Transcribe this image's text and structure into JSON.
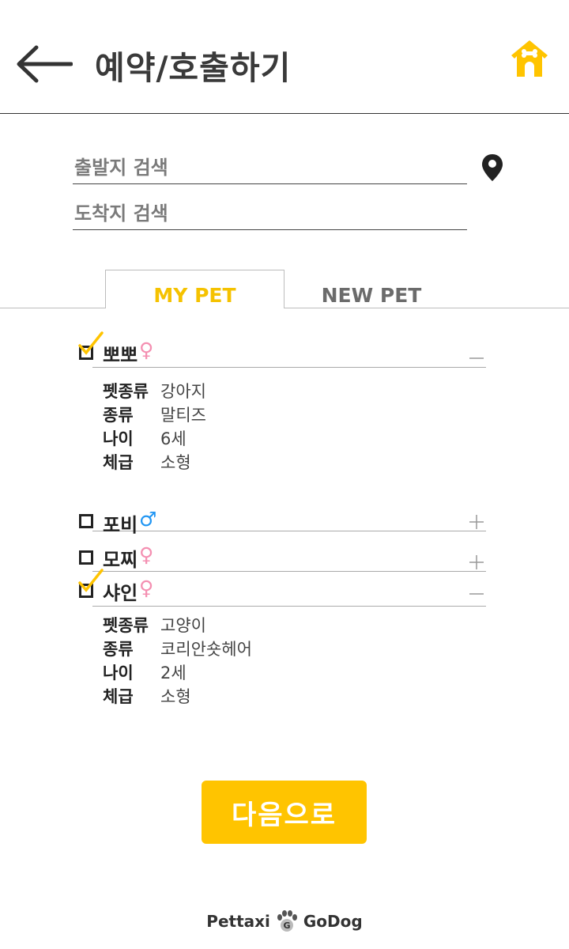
{
  "header": {
    "title": "예약/호출하기",
    "back_icon": "arrow-left-icon",
    "home_icon": "doghouse-home-icon",
    "accent_color": "#ffc400"
  },
  "search": {
    "departure_placeholder": "출발지 검색",
    "arrival_placeholder": "도착지 검색",
    "location_icon": "map-pin-icon"
  },
  "tabs": [
    {
      "label": "MY PET",
      "active": true
    },
    {
      "label": "NEW PET",
      "active": false
    }
  ],
  "pets": [
    {
      "name": "뽀뽀",
      "gender_symbol": "♀",
      "checked": true,
      "expanded": true,
      "toggle_icon": "minus-icon",
      "details": [
        {
          "label": "펫종류",
          "value": "강아지"
        },
        {
          "label": "종류",
          "value": "말티즈"
        },
        {
          "label": "나이",
          "value": "6세"
        },
        {
          "label": "체급",
          "value": "소형"
        }
      ]
    },
    {
      "name": "포비",
      "gender_symbol": "♂",
      "checked": false,
      "expanded": false,
      "toggle_icon": "plus-icon"
    },
    {
      "name": "모찌",
      "gender_symbol": "♀",
      "checked": false,
      "expanded": false,
      "toggle_icon": "plus-icon"
    },
    {
      "name": "샤인",
      "gender_symbol": "♀",
      "checked": true,
      "expanded": true,
      "toggle_icon": "minus-icon",
      "details": [
        {
          "label": "펫종류",
          "value": "고양이"
        },
        {
          "label": "종류",
          "value": "코리안숏헤어"
        },
        {
          "label": "나이",
          "value": "2세"
        },
        {
          "label": "체급",
          "value": "소형"
        }
      ]
    }
  ],
  "next_button": {
    "label": "다음으로"
  },
  "footer": {
    "brand_left": "Pettaxi",
    "brand_right": "GoDog",
    "logo_icon": "paw-logo-icon"
  }
}
